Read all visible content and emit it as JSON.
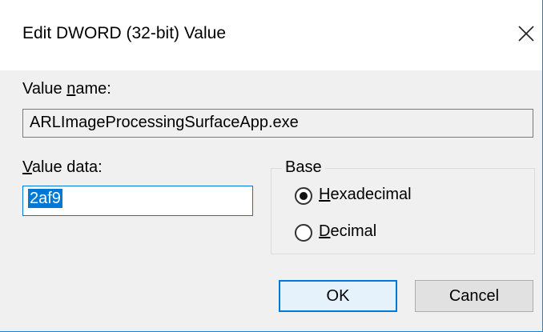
{
  "window": {
    "title": "Edit DWORD (32-bit) Value",
    "close_glyph": "✕"
  },
  "value_name": {
    "label_prefix": "Value ",
    "label_accel": "n",
    "label_suffix": "ame:",
    "value": "ARLImageProcessingSurfaceApp.exe"
  },
  "value_data": {
    "label_accel": "V",
    "label_suffix": "alue data:",
    "value": "2af9"
  },
  "base": {
    "legend": "Base",
    "options": [
      {
        "accel": "H",
        "rest": "exadecimal",
        "selected": true
      },
      {
        "accel": "D",
        "rest": "ecimal",
        "selected": false
      }
    ]
  },
  "buttons": {
    "ok": "OK",
    "cancel": "Cancel"
  },
  "colors": {
    "accent": "#0078d7",
    "dialog_bg": "#f0f0f0",
    "window_border": "#1883d7"
  }
}
